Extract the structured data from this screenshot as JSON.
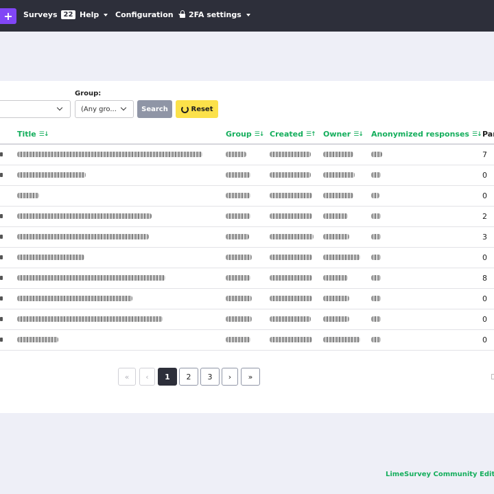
{
  "nav": {
    "plus": "+",
    "surveys_label": "Surveys",
    "surveys_count": "22",
    "help_label": "Help",
    "configuration_label": "Configuration",
    "twofa_label": "2FA settings"
  },
  "filters": {
    "group_label": "Group:",
    "group_value": "(Any gro...",
    "search_label": "Search",
    "reset_label": "Reset"
  },
  "table": {
    "columns": [
      "Title",
      "Group",
      "Created",
      "Owner",
      "Anonymized responses",
      "Par"
    ],
    "partial": [
      "7",
      "0",
      "0",
      "2",
      "3",
      "0",
      "8",
      "0",
      "0",
      "0"
    ]
  },
  "pagination": {
    "first": "«",
    "prev": "‹",
    "pages": [
      "1",
      "2",
      "3"
    ],
    "next": "›",
    "last": "»",
    "current": "1"
  },
  "footer": "LimeSurvey Community Edition"
}
